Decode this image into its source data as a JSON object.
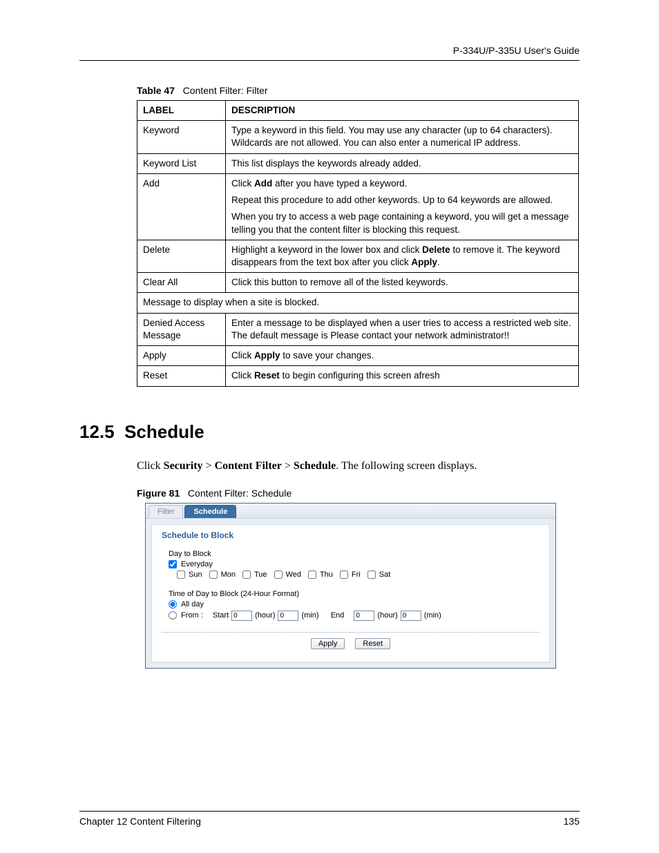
{
  "header": {
    "guide_title": "P-334U/P-335U User's Guide"
  },
  "table_caption": {
    "prefix": "Table 47",
    "title": "Content Filter: Filter"
  },
  "table": {
    "headers": {
      "label": "LABEL",
      "description": "DESCRIPTION"
    },
    "rows": {
      "keyword": {
        "label": "Keyword",
        "desc": "Type a keyword in this field. You may use any character (up to 64 characters). Wildcards are not allowed. You can also enter a numerical IP address."
      },
      "keyword_list": {
        "label": "Keyword List",
        "desc": "This list displays the keywords already added."
      },
      "add": {
        "label": "Add",
        "p1_a": "Click ",
        "p1_bold": "Add",
        "p1_b": " after you have typed a keyword.",
        "p2": "Repeat this procedure to add other keywords. Up to 64 keywords are allowed.",
        "p3": "When you try to access a web page containing a keyword, you will get a message telling you that the content filter is blocking this request."
      },
      "delete": {
        "label": "Delete",
        "a": "Highlight a keyword in the lower box and click ",
        "bold1": "Delete",
        "b": " to remove it. The keyword disappears from the text box after you click ",
        "bold2": "Apply",
        "c": "."
      },
      "clear_all": {
        "label": "Clear All",
        "desc": "Click this button to remove all of the listed keywords."
      },
      "message_span": "Message to display when a site is blocked.",
      "denied": {
        "label": "Denied Access Message",
        "desc": "Enter a message to be displayed when a user tries to access a restricted web site. The default message is Please contact your network administrator!!"
      },
      "apply": {
        "label": "Apply",
        "a": "Click ",
        "bold": "Apply",
        "b": " to save your changes."
      },
      "reset": {
        "label": "Reset",
        "a": "Click ",
        "bold": "Reset",
        "b": " to begin configuring this screen afresh"
      }
    }
  },
  "section": {
    "number": "12.5",
    "title": "Schedule"
  },
  "intro": {
    "a": "Click ",
    "b1": "Security",
    "s1": " > ",
    "b2": "Content Filter",
    "s2": " > ",
    "b3": "Schedule",
    "c": ". The following screen displays."
  },
  "figure_caption": {
    "prefix": "Figure 81",
    "title": "Content Filter: Schedule"
  },
  "screenshot": {
    "tabs": {
      "filter": "Filter",
      "schedule": "Schedule"
    },
    "panel_title": "Schedule to Block",
    "day_to_block": "Day to Block",
    "everyday": "Everyday",
    "days": {
      "sun": "Sun",
      "mon": "Mon",
      "tue": "Tue",
      "wed": "Wed",
      "thu": "Thu",
      "fri": "Fri",
      "sat": "Sat"
    },
    "tod_label": "Time of Day to Block (24-Hour Format)",
    "all_day": "All day",
    "from": "From :",
    "start": "Start",
    "end": "End",
    "hour": "(hour)",
    "min": "(min)",
    "values": {
      "sh": "0",
      "sm": "0",
      "eh": "0",
      "em": "0"
    },
    "buttons": {
      "apply": "Apply",
      "reset": "Reset"
    }
  },
  "footer": {
    "chapter": "Chapter 12 Content Filtering",
    "page": "135"
  }
}
